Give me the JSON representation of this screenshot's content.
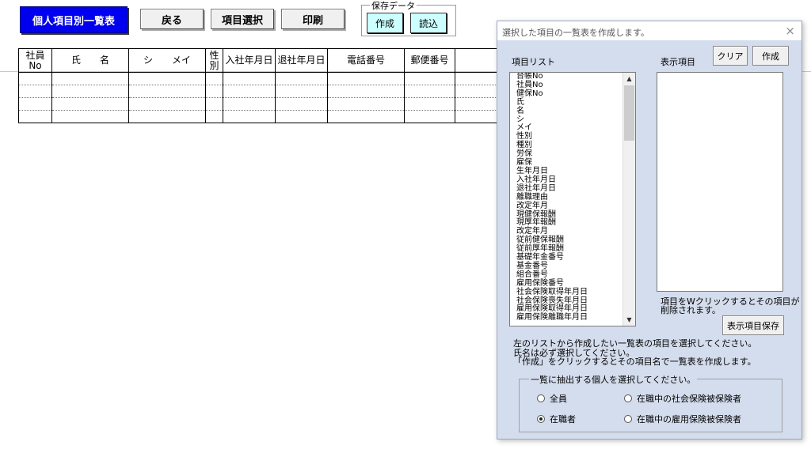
{
  "sheet": {
    "title_button": "個人項目別一覧表",
    "back_button": "戻る",
    "select_button": "項目選択",
    "print_button": "印刷",
    "save_data": {
      "legend": "保存データ",
      "create": "作成",
      "load": "読込"
    },
    "table_headers": [
      {
        "line1": "社員",
        "line2": "No"
      },
      {
        "line1": "氏　　名",
        "line2": ""
      },
      {
        "line1": "シ　　メイ",
        "line2": ""
      },
      {
        "line1": "性",
        "line2": "別"
      },
      {
        "line1": "入社年月日",
        "line2": ""
      },
      {
        "line1": "退社年月日",
        "line2": ""
      },
      {
        "line1": "電話番号",
        "line2": ""
      },
      {
        "line1": "郵便番号",
        "line2": ""
      },
      {
        "line1": "",
        "line2": ""
      }
    ]
  },
  "dialog": {
    "title": "選択した項目の一覧表を作成します。",
    "close_icon": "×",
    "item_list_label": "項目リスト",
    "display_items_label": "表示項目",
    "clear_button": "クリア",
    "create_button": "作成",
    "items": [
      "台帳No",
      "社員No",
      "健保No",
      "氏",
      "名",
      "シ",
      "メイ",
      "性別",
      "種別",
      "労保",
      "雇保",
      "生年月日",
      "入社年月日",
      "退社年月日",
      "離職理由",
      "改定年月",
      "現健保報酬",
      "現厚年報酬",
      "改定年月",
      "従前健保報酬",
      "従前厚年報酬",
      "基礎年金番号",
      "基金番号",
      "組合番号",
      "雇用保険番号",
      "社会保険取得年月日",
      "社会保険喪失年月日",
      "雇用保険取得年月日",
      "雇用保険離職年月日"
    ],
    "display_note_1": "項目をWクリックするとその項目が",
    "display_note_2": "削除されます。",
    "save_display_button": "表示項目保存",
    "instructions": [
      "左のリストから作成したい一覧表の項目を選択してください。",
      "氏名は必ず選択してください。",
      "「作成」をクリックするとその項目名で一覧表を作成します。"
    ],
    "radio_group_label": "一覧に抽出する個人を選択してください。",
    "radio_options": {
      "all": "全員",
      "employed": "在職者",
      "social_ins": "在職中の社会保険被保険者",
      "employment_ins": "在職中の雇用保険被保険者"
    },
    "selected_radio": "employed"
  }
}
